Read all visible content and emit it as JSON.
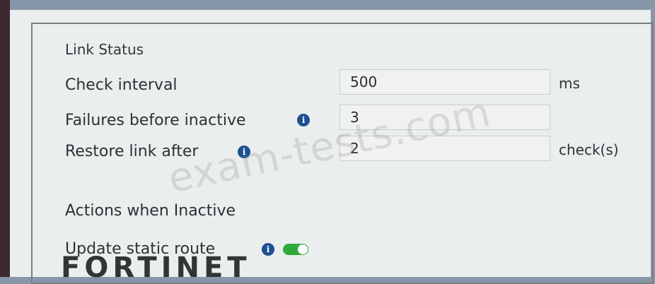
{
  "link_status": {
    "title": "Link Status",
    "check_interval": {
      "label": "Check interval",
      "value": "500",
      "unit": "ms"
    },
    "failures_before_inactive": {
      "label": "Failures before inactive",
      "value": "3"
    },
    "restore_link_after": {
      "label": "Restore link after",
      "value": "2",
      "unit": "check(s)"
    }
  },
  "actions": {
    "title": "Actions when Inactive",
    "update_static_route": {
      "label": "Update static route",
      "enabled": true
    }
  },
  "info_icon_glyph": "i",
  "watermark": "exam-tests.com",
  "brand": "FORTINET",
  "colors": {
    "info_icon": "#1d4f93",
    "toggle_on": "#2fa93a"
  }
}
